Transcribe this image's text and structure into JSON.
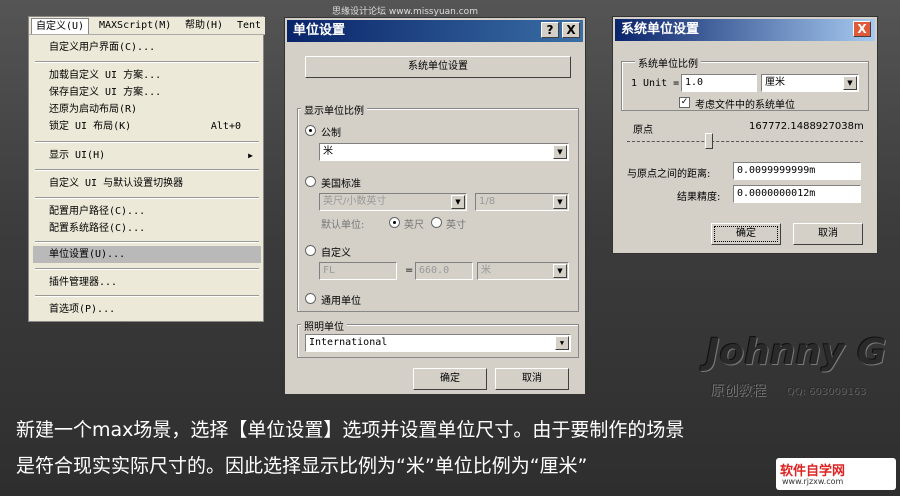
{
  "watermark": "思缘设计论坛 www.missyuan.com",
  "menu": {
    "bar": [
      "自定义(U)",
      "MAXScript(M)",
      "帮助(H)",
      "Tent"
    ],
    "items": [
      {
        "label": "自定义用户界面(C)...",
        "shortcut": ""
      },
      {
        "label": "加载自定义 UI 方案...",
        "shortcut": ""
      },
      {
        "label": "保存自定义 UI 方案...",
        "shortcut": ""
      },
      {
        "label": "还原为启动布局(R)",
        "shortcut": ""
      },
      {
        "label": "锁定 UI 布局(K)",
        "shortcut": "Alt+0"
      },
      {
        "label": "显示 UI(H)",
        "shortcut": ""
      },
      {
        "label": "自定义 UI 与默认设置切换器",
        "shortcut": ""
      },
      {
        "label": "配置用户路径(C)...",
        "shortcut": ""
      },
      {
        "label": "配置系统路径(C)...",
        "shortcut": ""
      },
      {
        "label": "单位设置(U)...",
        "shortcut": ""
      },
      {
        "label": "插件管理器...",
        "shortcut": ""
      },
      {
        "label": "首选项(P)...",
        "shortcut": ""
      }
    ]
  },
  "units_dialog": {
    "title": "单位设置",
    "help_btn": "?",
    "close_btn": "X",
    "system_btn": "系统单位设置",
    "display_group": "显示单位比例",
    "metric_label": "公制",
    "metric_value": "米",
    "us_label": "美国标准",
    "us_value": "英尺/小数英寸",
    "us_fraction": "1/8",
    "default_unit_label": "默认单位:",
    "feet_label": "英尺",
    "inch_label": "英寸",
    "custom_label": "自定义",
    "custom_name": "FL",
    "equals": "=",
    "custom_value": "660.0",
    "custom_unit": "米",
    "generic_label": "通用单位",
    "lighting_group": "照明单位",
    "lighting_value": "International",
    "ok": "确定",
    "cancel": "取消"
  },
  "system_dialog": {
    "title": "系统单位设置",
    "close_btn": "X",
    "group": "系统单位比例",
    "unit_label": "1 Unit =",
    "unit_value": "1.0",
    "unit_type": "厘米",
    "respect_files": "考虑文件中的系统单位",
    "origin_label": "原点",
    "origin_value": "167772.1488927038m",
    "distance_label": "与原点之间的距离:",
    "distance_value": "0.0099999999m",
    "precision_label": "结果精度:",
    "precision_value": "0.0000000012m",
    "ok": "确定",
    "cancel": "取消"
  },
  "logo": {
    "name": "Johnny G",
    "sub": "原创教程",
    "qq": "QQ: 603009163"
  },
  "caption": {
    "line1": "新建一个max场景，选择【单位设置】选项并设置单位尺寸。由于要制作的场景",
    "line2": "是符合现实实际尺寸的。因此选择显示比例为“米”单位比例为“厘米”"
  },
  "site_logo": {
    "brand": "软件自学网",
    "url": "www.rjzxw.com"
  }
}
